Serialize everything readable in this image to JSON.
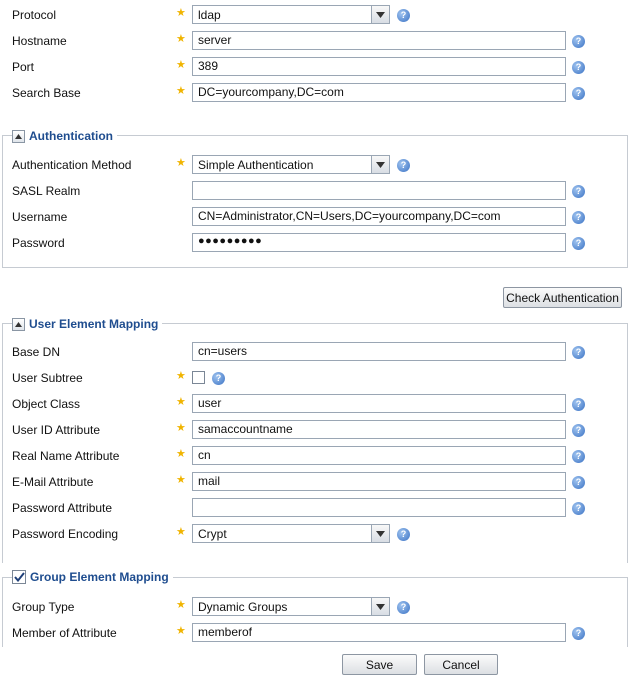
{
  "connection": {
    "protocol_label": "Protocol",
    "protocol_value": "ldap",
    "hostname_label": "Hostname",
    "hostname_value": "server",
    "port_label": "Port",
    "port_value": "389",
    "search_base_label": "Search Base",
    "search_base_value": "DC=yourcompany,DC=com"
  },
  "authentication": {
    "title": "Authentication",
    "method_label": "Authentication Method",
    "method_value": "Simple Authentication",
    "sasl_label": "SASL Realm",
    "sasl_value": "",
    "username_label": "Username",
    "username_value": "CN=Administrator,CN=Users,DC=yourcompany,DC=com",
    "password_label": "Password",
    "password_value": "●●●●●●●●●",
    "check_button": "Check Authentication"
  },
  "user_mapping": {
    "title": "User Element Mapping",
    "base_dn_label": "Base DN",
    "base_dn_value": "cn=users",
    "subtree_label": "User Subtree",
    "object_class_label": "Object Class",
    "object_class_value": "user",
    "user_id_label": "User ID Attribute",
    "user_id_value": "samaccountname",
    "real_name_label": "Real Name Attribute",
    "real_name_value": "cn",
    "email_label": "E-Mail Attribute",
    "email_value": "mail",
    "password_attr_label": "Password Attribute",
    "password_attr_value": "",
    "password_enc_label": "Password Encoding",
    "password_enc_value": "Crypt"
  },
  "group_mapping": {
    "title": "Group Element Mapping",
    "group_type_label": "Group Type",
    "group_type_value": "Dynamic Groups",
    "member_of_label": "Member of Attribute",
    "member_of_value": "memberof"
  },
  "footer": {
    "save": "Save",
    "cancel": "Cancel"
  },
  "icons": {
    "required": "required-star-icon",
    "help": "help-icon",
    "dropdown": "chevron-down-icon",
    "collapse": "collapse-arrow-icon",
    "check": "checkmark-icon"
  },
  "colors": {
    "section_title": "#1f4d8f",
    "required_star": "#f0b400",
    "help_icon": "#3a72c4"
  }
}
